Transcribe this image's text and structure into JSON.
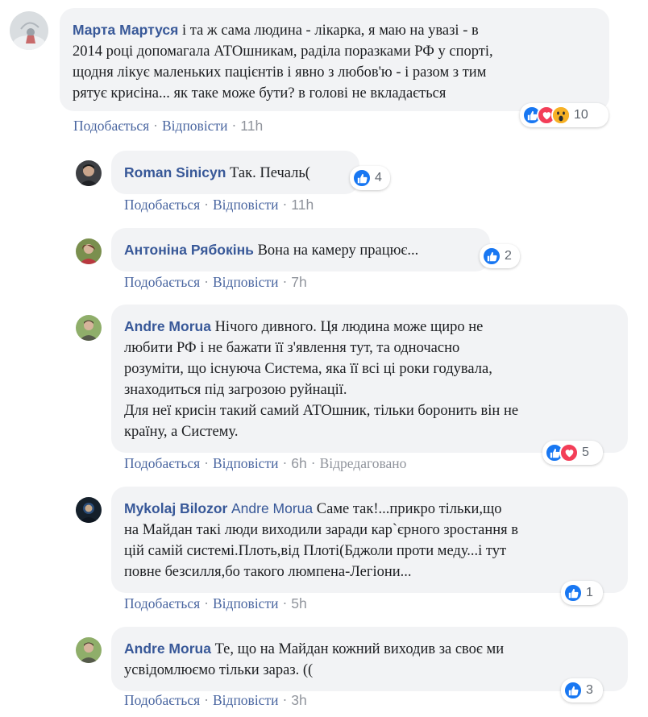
{
  "comments": [
    {
      "author": "Марта Мартуся",
      "text": "і та ж сама людина - лікарка, я маю на увазі - в\n2014 році допомагала АТОшникам, раділа поразками РФ у спорті,\nщодня лікує маленьких пацієнтів і явно з любов'ю - і разом з тим\nрятує крисіна... як таке може бути? в голові не вкладається",
      "like": "Подобається",
      "reply": "Відповісти",
      "time": "11h",
      "reaction_count": "10",
      "reaction_icons": [
        "like-icon",
        "love-icon",
        "wow-icon"
      ]
    },
    {
      "author": "Roman Sinicyn",
      "text": "Так. Печаль(",
      "like": "Подобається",
      "reply": "Відповісти",
      "time": "11h",
      "reaction_count": "4",
      "reaction_icons": [
        "like-icon"
      ]
    },
    {
      "author": "Антоніна Рябокінь",
      "text": "Вона на камеру працює...",
      "like": "Подобається",
      "reply": "Відповісти",
      "time": "7h",
      "reaction_count": "2",
      "reaction_icons": [
        "like-icon"
      ]
    },
    {
      "author": "Andre Morua",
      "text": "Нічого дивного. Ця людина може щиро не\nлюбити РФ і не бажати її з'явлення тут, та одночасно\nрозуміти, що існуюча Система, яка її всі ці роки годувала,\nзнаходиться під загрозою руйнації.\nДля неї крисін такий самий АТОшник, тільки боронить він не\nкраїну, а Систему.",
      "like": "Подобається",
      "reply": "Відповісти",
      "time": "6h",
      "edited": "Відредаговано",
      "reaction_count": "5",
      "reaction_icons": [
        "like-icon",
        "love-icon"
      ]
    },
    {
      "author": "Mykolaj Bilozor",
      "mention": "Andre Morua",
      "text": "Саме так!...прикро тільки,що\nна Майдан такі люди виходили заради кар`єрного зростання в\nцій самій системі.Плоть,від Плоті(Бджоли проти меду...і тут\nповне безсилля,бо такого люмпена-Легіони...",
      "like": "Подобається",
      "reply": "Відповісти",
      "time": "5h",
      "reaction_count": "1",
      "reaction_icons": [
        "like-icon"
      ]
    },
    {
      "author": "Andre Morua",
      "text": "Те, що на Майдан кожний виходив за своє ми\nусвідомлюємо тільки зараз. ((",
      "like": "Подобається",
      "reply": "Відповісти",
      "time": "3h",
      "reaction_count": "3",
      "reaction_icons": [
        "like-icon"
      ]
    }
  ],
  "colors": {
    "name": "#385898",
    "link": "#4b67a1",
    "muted": "#90949c",
    "bubble": "#f2f3f5",
    "like": "#1877f2",
    "love": "#f33e58",
    "wow": "#f7b125"
  }
}
